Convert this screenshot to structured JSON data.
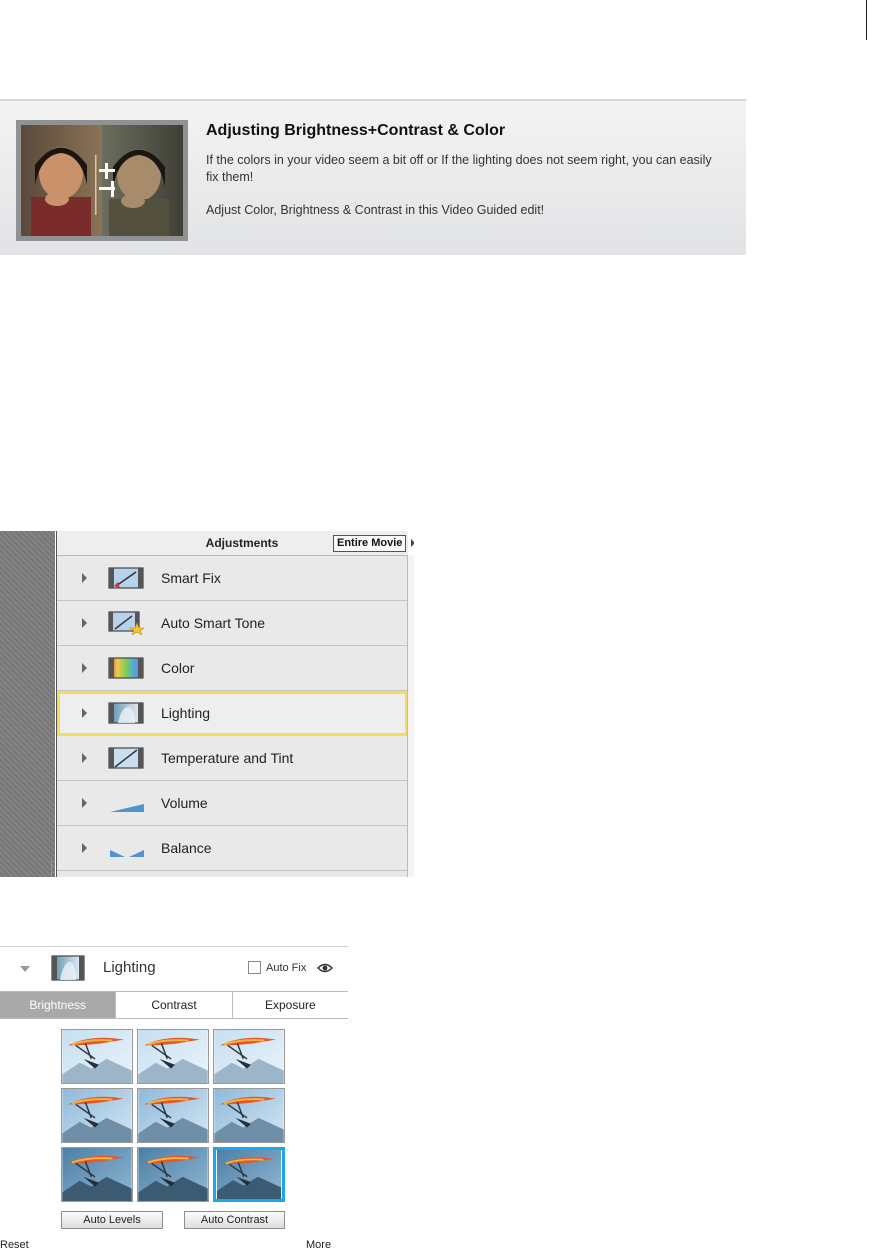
{
  "banner": {
    "title": "Adjusting Brightness+Contrast & Color",
    "description": "If the colors in your video seem a bit off or If the lighting does not seem right, you can easily fix them!",
    "description2": "Adjust Color, Brightness & Contrast in this Video Guided edit!"
  },
  "adjustments": {
    "title": "Adjustments",
    "scope": "Entire Movie",
    "items": [
      {
        "label": "Smart Fix",
        "icon": "smart-fix-icon"
      },
      {
        "label": "Auto Smart Tone",
        "icon": "auto-smart-tone-icon"
      },
      {
        "label": "Color",
        "icon": "color-icon"
      },
      {
        "label": "Lighting",
        "icon": "lighting-icon"
      },
      {
        "label": "Temperature and Tint",
        "icon": "temperature-tint-icon"
      },
      {
        "label": "Volume",
        "icon": "volume-icon"
      },
      {
        "label": "Balance",
        "icon": "balance-icon"
      }
    ],
    "highlighted": "Lighting"
  },
  "lighting": {
    "title": "Lighting",
    "auto_fix_label": "Auto Fix",
    "auto_fix_checked": false,
    "tabs": [
      {
        "label": "Brightness",
        "active": true
      },
      {
        "label": "Contrast",
        "active": false
      },
      {
        "label": "Exposure",
        "active": false
      }
    ],
    "selected_thumbnail": 8,
    "buttons": {
      "auto_levels": "Auto Levels",
      "auto_contrast": "Auto Contrast"
    },
    "links": {
      "reset": "Reset",
      "more": "More"
    }
  },
  "colors": {
    "highlight": "#f4dd5a",
    "selection": "#1ba7e8",
    "active_tab": "#a9a9a9"
  }
}
